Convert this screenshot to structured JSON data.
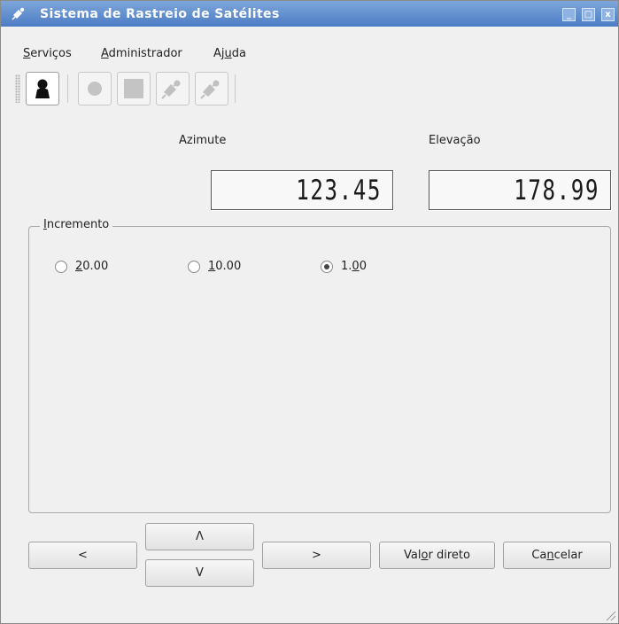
{
  "window": {
    "title": "Sistema de Rastreio de Satélites",
    "controls": {
      "minimize": "_",
      "maximize": "□",
      "close": "x"
    }
  },
  "menu": {
    "items": [
      {
        "label_pre": "",
        "label_u": "S",
        "label_post": "erviços"
      },
      {
        "label_pre": "",
        "label_u": "A",
        "label_post": "dministrador"
      },
      {
        "label_pre": "Aj",
        "label_u": "u",
        "label_post": "da"
      }
    ]
  },
  "toolbar": {
    "buttons": [
      "user-icon",
      "record-icon",
      "stop-icon",
      "satellite-icon",
      "satellite-icon"
    ]
  },
  "labels": {
    "azimute": "Azimute",
    "elevacao": "Elevação"
  },
  "displays": {
    "azimute": "123.45",
    "elevacao": "178.99"
  },
  "increment": {
    "title_u": "I",
    "title_post": "ncremento",
    "options": [
      {
        "u": "2",
        "post": "0.00",
        "selected": false
      },
      {
        "u": "1",
        "post": "0.00",
        "selected": false
      },
      {
        "pre": "1.",
        "u": "0",
        "post": "0",
        "selected": true
      }
    ]
  },
  "buttons": {
    "left": "<",
    "up": "Λ",
    "down": "V",
    "right": ">",
    "direct_pre": "Val",
    "direct_u": "o",
    "direct_post": "r direto",
    "cancel_pre": "Ca",
    "cancel_u": "n",
    "cancel_post": "celar"
  }
}
